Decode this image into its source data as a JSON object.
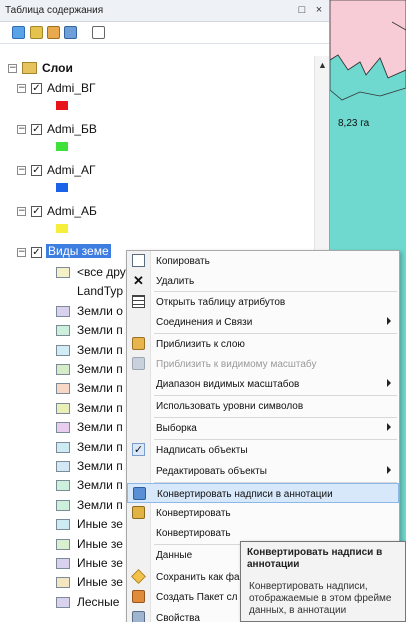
{
  "window": {
    "title": "Таблица содержания",
    "pin_glyph": "□",
    "close_glyph": "×"
  },
  "toolbar": {
    "icons": [
      "list-by-drawing-order-icon",
      "list-by-source-icon",
      "list-by-visibility-icon",
      "list-by-selection-icon",
      "options-icon"
    ]
  },
  "map": {
    "area_label": "8,23 га",
    "fill_color": "#6fd9cf"
  },
  "tree": {
    "root_label": "Слои",
    "layers": [
      {
        "label": "Admi_ВГ",
        "color": "#e8141c"
      },
      {
        "label": "Admi_БВ",
        "color": "#3ee03a"
      },
      {
        "label": "Admi_АГ",
        "color": "#1a63e8"
      },
      {
        "label": "Admi_АБ",
        "color": "#f6ee3a"
      }
    ],
    "selected_layer": "Виды земе",
    "legend_items": [
      {
        "label": "<все дру",
        "color": "#f5f0c8"
      },
      {
        "label": "LandTyp",
        "color": ""
      },
      {
        "label": "Земли о",
        "color": "#d8d2ee"
      },
      {
        "label": "Земли п",
        "color": "#cdf0dd"
      },
      {
        "label": "Земли п",
        "color": "#d2ecf6"
      },
      {
        "label": "Земли п",
        "color": "#d6ebc8"
      },
      {
        "label": "Земли п",
        "color": "#f7d8c6"
      },
      {
        "label": "Земли п",
        "color": "#e8f0b8"
      },
      {
        "label": "Земли п",
        "color": "#e8cdef"
      },
      {
        "label": "Земли п",
        "color": "#cdebf2"
      },
      {
        "label": "Земли п",
        "color": "#d2e9f5"
      },
      {
        "label": "Земли п",
        "color": "#cdf0dd"
      },
      {
        "label": "Земли п",
        "color": "#cdf0dd"
      },
      {
        "label": "Иные зе",
        "color": "#cdebf2"
      },
      {
        "label": "Иные зе",
        "color": "#d8f0cf"
      },
      {
        "label": "Иные зе",
        "color": "#d8d2ee"
      },
      {
        "label": "Иные зе",
        "color": "#f5e6c2"
      },
      {
        "label": "Лесные",
        "color": "#d8d2ee"
      }
    ]
  },
  "context_menu": {
    "items": [
      {
        "label": "Копировать",
        "icon": "copy-icon",
        "arrow": false,
        "disabled": false
      },
      {
        "label": "Удалить",
        "icon": "delete-icon",
        "arrow": false,
        "disabled": false
      },
      {
        "label": "Открыть таблицу атрибутов",
        "icon": "attribute-table-icon",
        "arrow": false,
        "disabled": false
      },
      {
        "label": "Соединения и Связи",
        "icon": "",
        "arrow": true,
        "disabled": false
      },
      {
        "label": "Приблизить к слою",
        "icon": "zoom-to-layer-icon",
        "arrow": false,
        "disabled": false
      },
      {
        "label": "Приблизить к видимому масштабу",
        "icon": "zoom-to-visible-scale-icon",
        "arrow": false,
        "disabled": true
      },
      {
        "label": "Диапазон видимых масштабов",
        "icon": "",
        "arrow": true,
        "disabled": false
      },
      {
        "label": "Использовать уровни символов",
        "icon": "",
        "arrow": false,
        "disabled": false
      },
      {
        "label": "Выборка",
        "icon": "",
        "arrow": true,
        "disabled": false
      },
      {
        "label": "Надписать объекты",
        "icon": "check-icon",
        "arrow": false,
        "disabled": false
      },
      {
        "label": "Редактировать объекты",
        "icon": "",
        "arrow": true,
        "disabled": false
      },
      {
        "label": "Конвертировать надписи в аннотации",
        "icon": "convert-labels-icon",
        "arrow": false,
        "disabled": false,
        "highlighted": true
      },
      {
        "label": "Конвертировать",
        "icon": "convert-features-icon",
        "arrow": false,
        "disabled": false
      },
      {
        "label": "Конвертировать",
        "icon": "",
        "arrow": false,
        "disabled": false
      },
      {
        "label": "Данные",
        "icon": "",
        "arrow": false,
        "disabled": false
      },
      {
        "label": "Сохранить как фа",
        "icon": "save-layer-icon",
        "arrow": false,
        "disabled": false
      },
      {
        "label": "Создать Пакет сл",
        "icon": "create-package-icon",
        "arrow": false,
        "disabled": false
      },
      {
        "label": "Свойства",
        "icon": "properties-icon",
        "arrow": false,
        "disabled": false
      }
    ]
  },
  "tooltip": {
    "title": "Конвертировать надписи в аннотации",
    "description": "Конвертировать надписи, отображаемые в этом фрейме данных, в аннотации"
  }
}
